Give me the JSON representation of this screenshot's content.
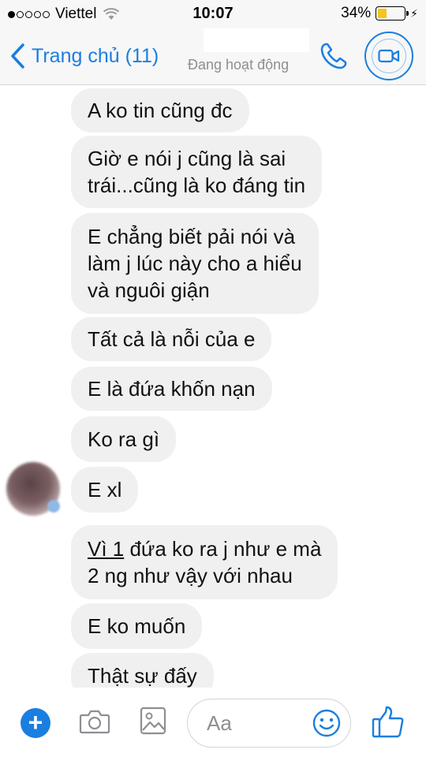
{
  "status_bar": {
    "carrier": "Viettel",
    "time": "10:07",
    "battery": "34%",
    "battery_level": 0.34
  },
  "header": {
    "back_label": "Trang chủ (11)",
    "contact_status": "Đang hoạt động"
  },
  "messages": [
    {
      "lines": [
        "A ko tin cũng đc"
      ]
    },
    {
      "lines": [
        "Giờ e nói j cũng là sai",
        "trái...cũng là ko đáng tin"
      ]
    },
    {
      "lines": [
        "E chẳng biết pải nói và",
        "làm j lúc này cho a hiểu",
        "và nguôi giận"
      ]
    },
    {
      "lines": [
        "Tất cả là nỗi của e"
      ]
    },
    {
      "lines": [
        "E là đứa khốn nạn"
      ]
    },
    {
      "lines": [
        "Ko ra gì"
      ]
    },
    {
      "lines": [
        "E xl"
      ]
    },
    {
      "underlined_prefix": "Vì 1",
      "lines": [
        " đứa ko ra j như e mà",
        "2 ng như vậy với nhau"
      ]
    },
    {
      "lines": [
        "E ko muốn"
      ]
    },
    {
      "lines": [
        "Thật sự đấy"
      ]
    }
  ],
  "composer": {
    "placeholder": "Aa"
  },
  "icons": {
    "back": "chevron-left-icon",
    "call": "phone-icon",
    "video": "video-camera-icon",
    "plus": "plus-icon",
    "camera": "camera-icon",
    "image": "image-icon",
    "emoji": "smiley-icon",
    "like": "thumbs-up-icon"
  },
  "colors": {
    "accent": "#1a7ee0",
    "bubble": "#f1f0f0",
    "battery_fill": "#f5c518"
  }
}
